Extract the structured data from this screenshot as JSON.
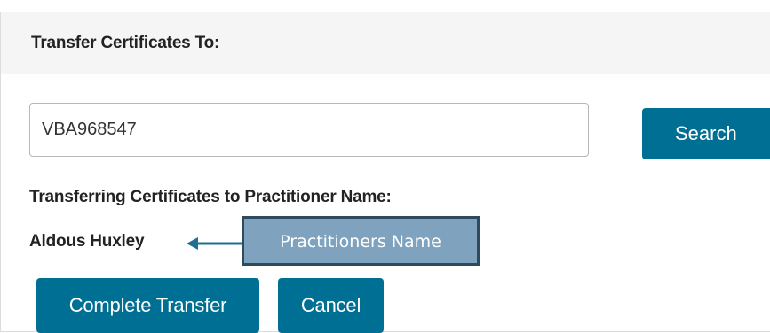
{
  "panel": {
    "title": "Transfer Certificates To:"
  },
  "search": {
    "value": "VBA968547",
    "button_label": "Search"
  },
  "result": {
    "heading": "Transferring Certificates to Practitioner Name:",
    "practitioner_name": "Aldous Huxley"
  },
  "annotation": {
    "callout_label": "Practitioners Name"
  },
  "actions": {
    "complete_label": "Complete Transfer",
    "cancel_label": "Cancel"
  },
  "colors": {
    "primary_button": "#006f94",
    "callout_fill": "#7fa3be",
    "callout_border": "#2f4a5c",
    "header_background": "#f5f5f5"
  },
  "icons": {
    "callout_pointer": "arrow-left-icon"
  }
}
